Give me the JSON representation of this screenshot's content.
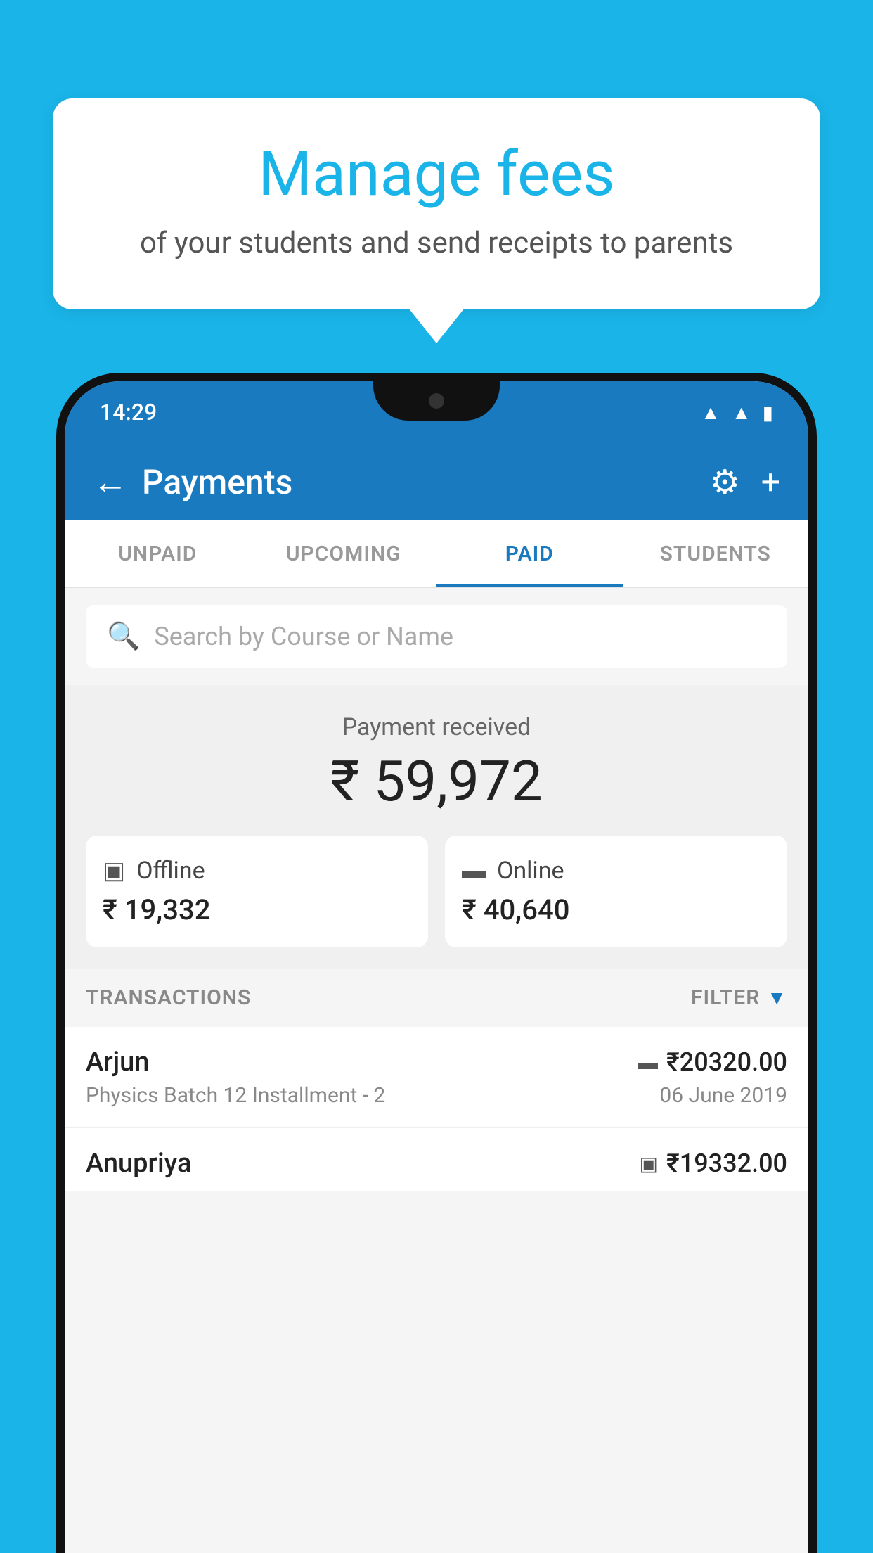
{
  "background_color": "#1ab4e8",
  "speech_bubble": {
    "title": "Manage fees",
    "subtitle": "of your students and send receipts to parents"
  },
  "status_bar": {
    "time": "14:29",
    "icons": [
      "wifi",
      "signal",
      "battery"
    ]
  },
  "top_bar": {
    "title": "Payments",
    "back_label": "←",
    "gear_label": "⚙",
    "plus_label": "+"
  },
  "tabs": [
    {
      "label": "UNPAID",
      "active": false
    },
    {
      "label": "UPCOMING",
      "active": false
    },
    {
      "label": "PAID",
      "active": true
    },
    {
      "label": "STUDENTS",
      "active": false
    }
  ],
  "search": {
    "placeholder": "Search by Course or Name"
  },
  "payment_summary": {
    "label": "Payment received",
    "amount": "₹ 59,972",
    "offline": {
      "label": "Offline",
      "amount": "₹ 19,332",
      "icon": "💳"
    },
    "online": {
      "label": "Online",
      "amount": "₹ 40,640",
      "icon": "💳"
    }
  },
  "transactions_header": {
    "label": "TRANSACTIONS",
    "filter_label": "FILTER"
  },
  "transactions": [
    {
      "name": "Arjun",
      "amount": "₹20320.00",
      "course": "Physics Batch 12 Installment - 2",
      "date": "06 June 2019",
      "type_icon": "💳"
    },
    {
      "name": "Anupriya",
      "amount": "₹19332.00",
      "course": "",
      "date": "",
      "type_icon": "💵"
    }
  ]
}
